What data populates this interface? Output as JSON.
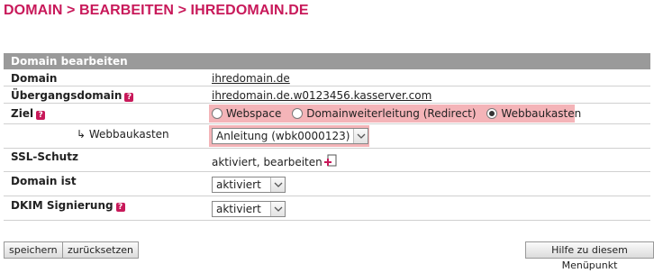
{
  "breadcrumb": "DOMAIN > BEARBEITEN > IHREDOMAIN.DE",
  "panel_title": "Domain bearbeiten",
  "rows": {
    "domain": {
      "label": "Domain",
      "value": "ihredomain.de"
    },
    "uebergang": {
      "label": "Übergangsdomain",
      "value": "ihredomain.de.w0123456.kasserver.com"
    },
    "ziel": {
      "label": "Ziel",
      "options": [
        "Webspace",
        "Domainweiterleitung (Redirect)",
        "Webbaukasten"
      ],
      "selected": "Webbaukasten"
    },
    "webbaukasten": {
      "label": "↳ Webbaukasten",
      "value": "Anleitung (wbk0000123)"
    },
    "ssl": {
      "label": "SSL-Schutz",
      "value_prefix": "aktiviert, ",
      "link": "bearbeiten"
    },
    "domain_ist": {
      "label": "Domain ist",
      "value": "aktiviert"
    },
    "dkim": {
      "label": "DKIM Signierung",
      "value": "aktiviert"
    }
  },
  "buttons": {
    "save": "speichern",
    "reset": "zurücksetzen",
    "help": "Hilfe zu diesem Menüpunkt"
  },
  "colors": {
    "accent": "#c8195a",
    "header_bg": "#9a9a9a",
    "highlight": "#f4b4b8"
  },
  "icons": {
    "help": "question-badge-icon",
    "ssl_add": "page-plus-icon",
    "select": "chevron-down-icon"
  }
}
